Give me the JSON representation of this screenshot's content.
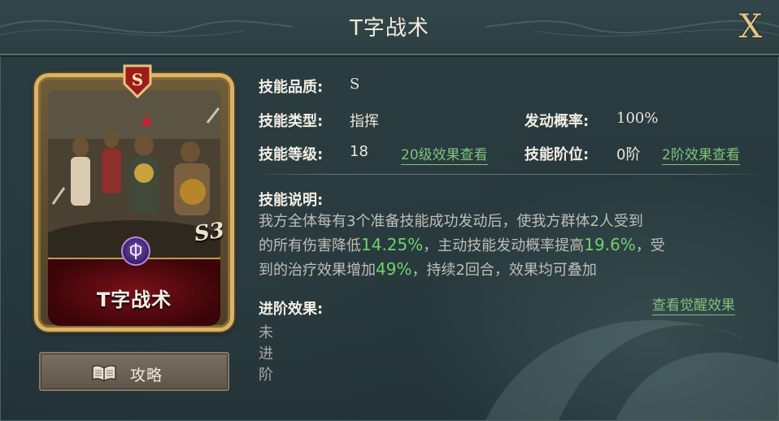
{
  "window": {
    "title": "T字战术",
    "close_label": "X"
  },
  "card": {
    "name": "T字战术",
    "grade": "S",
    "season": "S3"
  },
  "guide_button": {
    "label": "攻略",
    "icon": "book-icon"
  },
  "skill": {
    "quality_label": "技能品质:",
    "quality_value": "S",
    "type_label": "技能类型:",
    "type_value": "指挥",
    "trigger_label": "发动概率:",
    "trigger_value": "100%",
    "level_label": "技能等级:",
    "level_value": "18",
    "level_link": "20级效果查看",
    "stage_label": "技能阶位:",
    "stage_value": "0阶",
    "stage_link": "2阶效果查看",
    "desc_label": "技能说明:",
    "desc": {
      "l1": "我方全体每有3个准备技能成功发动后，使我方群体2人受到",
      "l2a": "的所有伤害降低",
      "l2b": "14.25%",
      "l2c": "，主动技能发动概率提高",
      "l2d": "19.6%",
      "l2e": "，受",
      "l3a": "到的治疗效果增加",
      "l3b": "49%",
      "l3c": "，持续2回合，效果均可叠加"
    },
    "advance_label": "进阶效果:",
    "advance_link": "查看觉醒效果",
    "advance_value": "未进阶"
  },
  "colors": {
    "highlight": "#6fd36a",
    "link": "#7fc37a",
    "gold": "#d8b468"
  }
}
